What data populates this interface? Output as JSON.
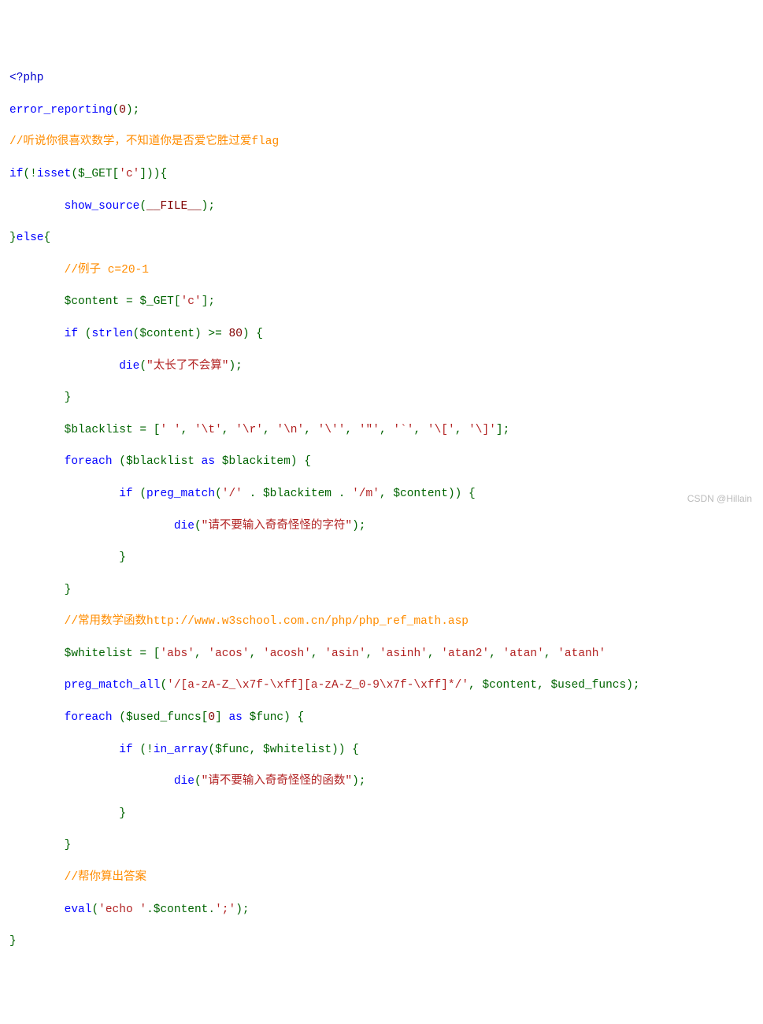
{
  "code": {
    "l01": {
      "a": "<?php"
    },
    "l02": {
      "a": "error_reporting",
      "b": "(",
      "c": "0",
      "d": ");"
    },
    "l03": {
      "a": "//听说你很喜欢数学，不知道你是否爱它胜过爱flag"
    },
    "l04": {
      "a": "if",
      "b": "(!",
      "c": "isset",
      "d": "(",
      "e": "$_GET",
      "f": "[",
      "g": "'c'",
      "h": "])){"
    },
    "l05": {
      "a": "        ",
      "b": "show_source",
      "c": "(",
      "d": "__FILE__",
      "e": ");"
    },
    "l06": {
      "a": "}",
      "b": "else",
      "c": "{"
    },
    "l07": {
      "a": "        ",
      "b": "//例子 c=20-1"
    },
    "l08": {
      "a": "        ",
      "b": "$content ",
      "c": "= ",
      "d": "$_GET",
      "e": "[",
      "f": "'c'",
      "g": "];"
    },
    "l09": {
      "a": "        ",
      "b": "if ",
      "c": "(",
      "d": "strlen",
      "e": "(",
      "f": "$content",
      "g": ") >= ",
      "h": "80",
      "i": ") {"
    },
    "l10": {
      "a": "                ",
      "b": "die",
      "c": "(",
      "d": "\"太长了不会算\"",
      "e": ");"
    },
    "l11": {
      "a": "        ",
      "b": "}"
    },
    "l12": {
      "a": "        ",
      "b": "$blacklist ",
      "c": "= [",
      "s1": "' '",
      "s2": "'\\t'",
      "s3": "'\\r'",
      "s4": "'\\n'",
      "s5": "'\\''",
      "s6": "'\"'",
      "s7": "'`'",
      "s8": "'\\['",
      "s9": "'\\]'",
      "end": "];",
      "comma": ", "
    },
    "l13": {
      "a": "        ",
      "b": "foreach ",
      "c": "(",
      "d": "$blacklist ",
      "e": "as ",
      "f": "$blackitem",
      "g": ") {"
    },
    "l14": {
      "a": "                ",
      "b": "if ",
      "c": "(",
      "d": "preg_match",
      "e": "(",
      "f": "'/' ",
      "g": ". ",
      "h": "$blackitem ",
      "i": ". ",
      "j": "'/m'",
      "k": ", ",
      "l": "$content",
      "m": ")) {"
    },
    "l15": {
      "a": "                        ",
      "b": "die",
      "c": "(",
      "d": "\"请不要输入奇奇怪怪的字符\"",
      "e": ");"
    },
    "l16": {
      "a": "                ",
      "b": "}"
    },
    "l17": {
      "a": "        ",
      "b": "}"
    },
    "l18": {
      "a": "        ",
      "b": "//常用数学函数http://www.w3school.com.cn/php/php_ref_math.asp"
    },
    "l19": {
      "a": "        ",
      "b": "$whitelist ",
      "c": "= [",
      "s1": "'abs'",
      "s2": "'acos'",
      "s3": "'acosh'",
      "s4": "'asin'",
      "s5": "'asinh'",
      "s6": "'atan2'",
      "s7": "'atan'",
      "s8": "'atanh'",
      "comma": ", "
    },
    "l20": {
      "a": "        ",
      "b": "preg_match_all",
      "c": "(",
      "d": "'/[a-zA-Z_\\x7f-\\xff][a-zA-Z_0-9\\x7f-\\xff]*/'",
      "e": ", ",
      "f": "$content",
      "g": ", ",
      "h": "$used_funcs",
      "i": ");"
    },
    "l21": {
      "a": "        ",
      "b": "foreach ",
      "c": "(",
      "d": "$used_funcs",
      "e": "[",
      "f": "0",
      "g": "] ",
      "h": "as ",
      "i": "$func",
      "j": ") {"
    },
    "l22": {
      "a": "                ",
      "b": "if ",
      "c": "(!",
      "d": "in_array",
      "e": "(",
      "f": "$func",
      "g": ", ",
      "h": "$whitelist",
      "i": ")) {"
    },
    "l23": {
      "a": "                        ",
      "b": "die",
      "c": "(",
      "d": "\"请不要输入奇奇怪怪的函数\"",
      "e": ");"
    },
    "l24": {
      "a": "                ",
      "b": "}"
    },
    "l25": {
      "a": "        ",
      "b": "}"
    },
    "l26": {
      "a": "        ",
      "b": "//帮你算出答案"
    },
    "l27": {
      "a": "        ",
      "b": "eval",
      "c": "(",
      "d": "'echo '",
      "e": ".",
      "f": "$content",
      "g": ".",
      "h": "';'",
      "i": ");"
    },
    "l28": {
      "a": "}"
    }
  },
  "watermark": "CSDN @Hillain"
}
